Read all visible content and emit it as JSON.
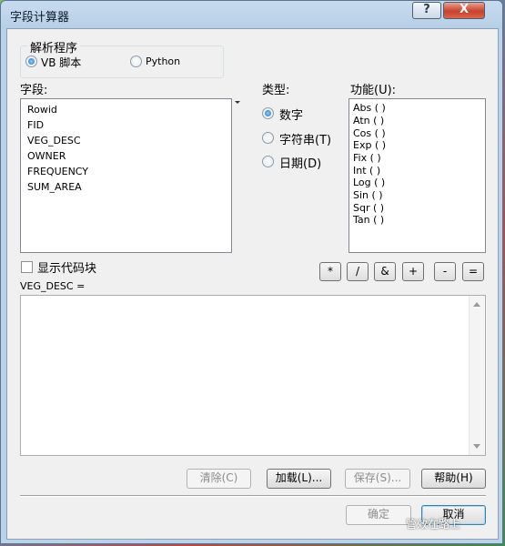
{
  "window": {
    "title": "字段计算器",
    "help_glyph": "?",
    "close_glyph": "X"
  },
  "parser": {
    "legend": "解析程序",
    "vb_label": "VB 脚本",
    "python_label": "Python",
    "selected": "VB 脚本"
  },
  "fields": {
    "label": "字段:",
    "items": [
      "Rowid",
      "FID",
      "VEG_DESC",
      "OWNER",
      "FREQUENCY",
      "SUM_AREA"
    ]
  },
  "type_section": {
    "label": "类型:",
    "options": [
      "数字",
      "字符串(T)",
      "日期(D)"
    ],
    "selected": "数字"
  },
  "functions": {
    "label": "功能(U):",
    "items": [
      "Abs ( )",
      "Atn ( )",
      "Cos ( )",
      "Exp ( )",
      "Fix ( )",
      "Int ( )",
      "Log ( )",
      "Sin ( )",
      "Sqr ( )",
      "Tan ( )"
    ]
  },
  "codeblock": {
    "label": "显示代码块",
    "checked": false
  },
  "operators": [
    "*",
    "/",
    "&",
    "+",
    "-",
    "="
  ],
  "expression": {
    "label": "VEG_DESC =",
    "value": ""
  },
  "buttons": {
    "clear": "清除(C)",
    "load": "加载(L)...",
    "save": "保存(S)...",
    "help": "帮助(H)",
    "ok": "确定",
    "cancel": "取消"
  },
  "watermark": "管效在路上"
}
